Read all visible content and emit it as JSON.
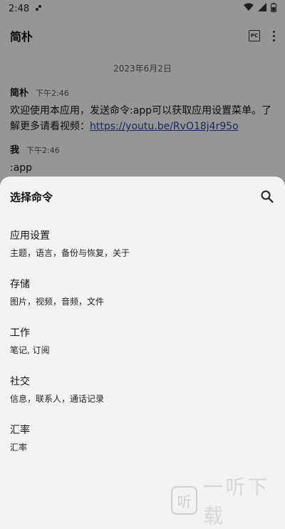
{
  "status_bar": {
    "time": "2:48"
  },
  "app_bar": {
    "title": "简朴",
    "pc_label": "PC"
  },
  "chat": {
    "date": "2023年6月2日",
    "messages": [
      {
        "sender": "简朴",
        "time": "下午2:46",
        "text": "欢迎使用本应用，发送命令:app可以获取应用设置菜单。了解更多请看视频：",
        "link": "https://youtu.be/RvO18j4r95o"
      },
      {
        "sender": "我",
        "time": "下午2:46",
        "text": ":app"
      }
    ]
  },
  "sheet": {
    "title": "选择命令",
    "items": [
      {
        "name": "应用设置",
        "desc": "主题，语言，备份与恢复，关于"
      },
      {
        "name": "存储",
        "desc": "图片，视频，音频，文件"
      },
      {
        "name": "工作",
        "desc": "笔记, 订阅"
      },
      {
        "name": "社交",
        "desc": "信息，联系人，通话记录"
      },
      {
        "name": "汇率",
        "desc": "汇率"
      }
    ]
  },
  "watermark": {
    "text": "一听下载",
    "logo": "听"
  }
}
